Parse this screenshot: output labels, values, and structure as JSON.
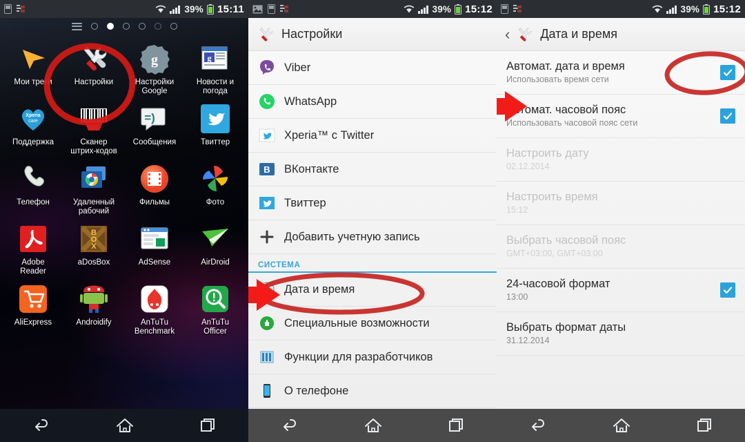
{
  "panels": {
    "home": {
      "statusbar": {
        "icons": [
          "sim-card-icon",
          "sync-icon"
        ],
        "wifi": "wifi-icon",
        "signal": "signal-icon",
        "battery_percent": "39%",
        "battery": "battery-icon",
        "time": "15:11"
      },
      "pager": {
        "pages": 6,
        "active_index": 1
      },
      "apps": [
        {
          "label": "Мои треки",
          "icon": "navigation-arrow-icon"
        },
        {
          "label": "Настройки",
          "icon": "tools-wrench-screwdriver-icon"
        },
        {
          "label": "Настройки\nGoogle",
          "icon": "google-gear-icon"
        },
        {
          "label": "Новости и\nпогода",
          "icon": "google-news-icon"
        },
        {
          "label": "Поддержка",
          "icon": "xperia-care-icon"
        },
        {
          "label": "Сканер\nштрих-кодов",
          "icon": "barcode-scanner-icon"
        },
        {
          "label": "Сообщения",
          "icon": "messaging-bubble-icon"
        },
        {
          "label": "Твиттер",
          "icon": "twitter-bird-icon"
        },
        {
          "label": "Телефон",
          "icon": "phone-handset-icon"
        },
        {
          "label": "Удаленный\nрабочий",
          "icon": "chrome-remote-desktop-icon"
        },
        {
          "label": "Фильмы",
          "icon": "movies-film-icon"
        },
        {
          "label": "Фото",
          "icon": "google-photos-icon"
        },
        {
          "label": "Adobe\nReader",
          "icon": "adobe-reader-icon"
        },
        {
          "label": "aDosBox",
          "icon": "adosbox-icon"
        },
        {
          "label": "AdSense",
          "icon": "adsense-icon"
        },
        {
          "label": "AirDroid",
          "icon": "airdroid-icon"
        },
        {
          "label": "AliExpress",
          "icon": "aliexpress-cart-icon"
        },
        {
          "label": "Androidify",
          "icon": "androidify-icon"
        },
        {
          "label": "AnTuTu\nBenchmark",
          "icon": "antutu-benchmark-icon"
        },
        {
          "label": "AnTuTu\nOfficer",
          "icon": "antutu-officer-icon"
        }
      ],
      "navbar": {
        "back": "back-icon",
        "home": "home-icon",
        "recents": "recents-icon"
      }
    },
    "settings": {
      "statusbar": {
        "icons": [
          "image-icon",
          "sim-card-icon",
          "sync-icon"
        ],
        "battery_percent": "39%",
        "time": "15:12"
      },
      "header": {
        "title": "Настройки",
        "icon": "tools-wrench-screwdriver-icon"
      },
      "rows": [
        {
          "label": "Viber",
          "icon": "viber-icon"
        },
        {
          "label": "WhatsApp",
          "icon": "whatsapp-icon"
        },
        {
          "label": "Xperia™ с Twitter",
          "icon": "twitter-bird-icon"
        },
        {
          "label": "ВКонтакте",
          "icon": "vk-icon"
        },
        {
          "label": "Твиттер",
          "icon": "twitter-bird-icon"
        },
        {
          "label": "Добавить учетную запись",
          "icon": "plus-icon"
        }
      ],
      "section_label": "СИСТЕМА",
      "system_rows": [
        {
          "label": "Дата и время",
          "icon": "clock-icon",
          "highlighted": true
        },
        {
          "label": "Специальные возможности",
          "icon": "accessibility-hand-icon"
        },
        {
          "label": "Функции для разработчиков",
          "icon": "developer-options-icon"
        },
        {
          "label": "О телефоне",
          "icon": "phone-device-icon"
        }
      ],
      "navbar": {
        "back": "back-icon",
        "home": "home-icon",
        "recents": "recents-icon"
      }
    },
    "datetime": {
      "statusbar": {
        "icons": [
          "sim-card-icon",
          "sync-icon"
        ],
        "battery_percent": "39%",
        "time": "15:12"
      },
      "header": {
        "back": "back-chevron-icon",
        "icon": "tools-wrench-screwdriver-icon",
        "title": "Дата и время"
      },
      "rows": [
        {
          "title": "Автомат. дата и время",
          "subtitle": "Использовать время сети",
          "checked": true,
          "disabled": false,
          "highlighted": true
        },
        {
          "title": "Автомат. часовой пояс",
          "subtitle": "Использовать часовой пояс сети",
          "checked": true,
          "disabled": false
        },
        {
          "title": "Настроить дату",
          "subtitle": "02.12.2014",
          "checked": null,
          "disabled": true
        },
        {
          "title": "Настроить время",
          "subtitle": "15:12",
          "checked": null,
          "disabled": true
        },
        {
          "title": "Выбрать часовой пояс",
          "subtitle": "GMT+03:00, GMT+03:00",
          "checked": null,
          "disabled": true
        },
        {
          "title": "24-часовой формат",
          "subtitle": "13:00",
          "checked": true,
          "disabled": false
        },
        {
          "title": "Выбрать формат даты",
          "subtitle": "31.12.2014",
          "checked": null,
          "disabled": false
        }
      ],
      "navbar": {
        "back": "back-icon",
        "home": "home-icon",
        "recents": "recents-icon"
      }
    }
  },
  "annotations": {
    "accent_red": "#e01b1b",
    "marks": [
      {
        "name": "circle-around-settings-app",
        "shape": "ellipse"
      },
      {
        "name": "circle-around-date-time-row",
        "shape": "ellipse"
      },
      {
        "name": "circle-around-auto-datetime-checkbox",
        "shape": "ellipse"
      },
      {
        "name": "arrow-to-date-time-row",
        "shape": "arrow"
      },
      {
        "name": "arrow-to-auto-datetime-row",
        "shape": "arrow"
      }
    ]
  },
  "colors": {
    "status_bar_bg": "#2b2f33",
    "list_bg": "#f5f5f5",
    "checkbox_blue": "#2aa3dd",
    "section_blue": "#35a8dd",
    "navbar_grey": "#4a4a4a",
    "navbar_dark": "#13171f"
  }
}
